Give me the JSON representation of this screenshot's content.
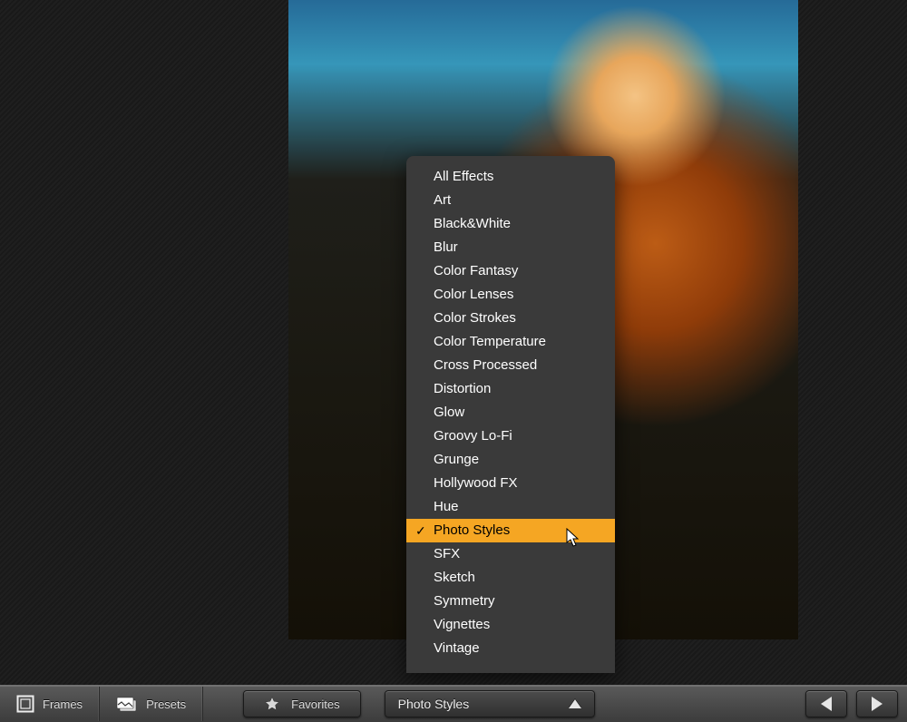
{
  "toolbar": {
    "frames_label": "Frames",
    "presets_label": "Presets",
    "favorites_label": "Favorites",
    "dropdown_label": "Photo Styles"
  },
  "effects_menu": {
    "selected_index": 14,
    "items": [
      "All Effects",
      "Art",
      "Black&White",
      "Blur",
      "Color Fantasy",
      "Color Lenses",
      "Color Strokes",
      "Color Temperature",
      "Cross Processed",
      "Distortion",
      "Glow",
      "Groovy Lo-Fi",
      "Grunge",
      "Hollywood FX",
      "Hue",
      "Photo Styles",
      "SFX",
      "Sketch",
      "Symmetry",
      "Vignettes",
      "Vintage"
    ]
  },
  "colors": {
    "menu_highlight": "#f5a623"
  }
}
